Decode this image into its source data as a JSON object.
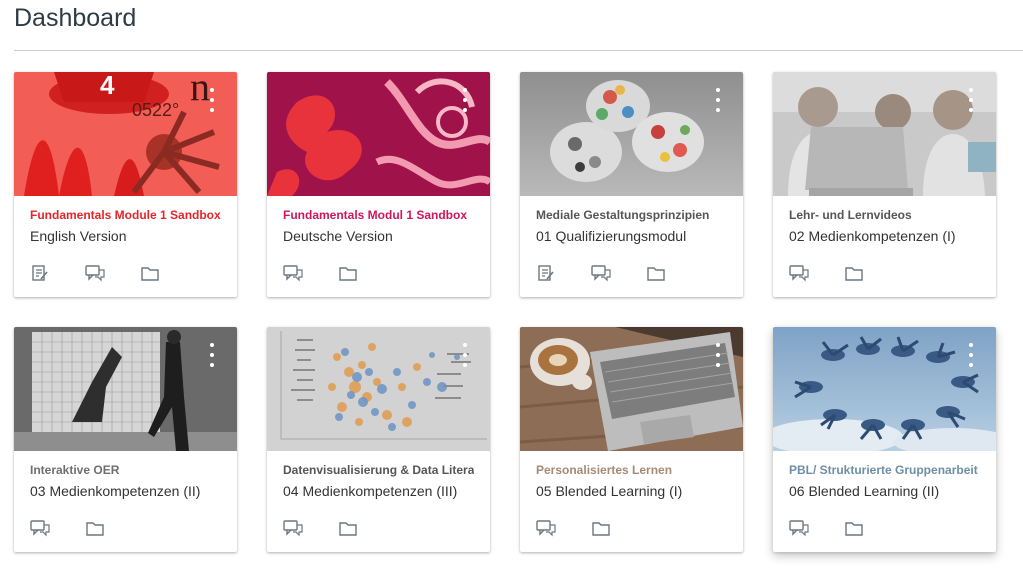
{
  "page": {
    "title": "Dashboard"
  },
  "cards": [
    {
      "course_name": "Fundamentals Module 1 Sandbox",
      "subtitle": "English Version",
      "name_color": "#e62429",
      "icons": [
        "assignments-icon",
        "discussions-icon",
        "files-icon"
      ],
      "image": "red-abstract-illustration",
      "image_text": {
        "big": "4",
        "num": "0522°",
        "glyph": "n"
      }
    },
    {
      "course_name": "Fundamentals Modul 1 Sandbox",
      "subtitle": "Deutsche Version",
      "name_color": "#d0155a",
      "icons": [
        "discussions-icon",
        "files-icon"
      ],
      "image": "magenta-abstract-illustration"
    },
    {
      "course_name": "Mediale Gestaltungsprinzipien",
      "subtitle": "01 Qualifizierungsmodul",
      "name_color": "#555555",
      "icons": [
        "assignments-icon",
        "discussions-icon",
        "files-icon"
      ],
      "image": "dotted-eggs-photo"
    },
    {
      "course_name": "Lehr- und Lernvideos",
      "subtitle": "02 Medienkompetenzen (I)",
      "name_color": "#555555",
      "icons": [
        "discussions-icon",
        "files-icon"
      ],
      "image": "girls-with-laptop-photo"
    },
    {
      "course_name": "Interaktive OER",
      "subtitle": "03 Medienkompetenzen (II)",
      "name_color": "#6f6f6f",
      "icons": [
        "discussions-icon",
        "files-icon"
      ],
      "image": "pixel-wall-photo"
    },
    {
      "course_name": "Datenvisualisierung & Data Literacy",
      "subtitle": "04 Medienkompetenzen (III)",
      "name_color": "#555555",
      "icons": [
        "discussions-icon",
        "files-icon"
      ],
      "image": "scatter-plot-image"
    },
    {
      "course_name": "Personalisiertes Lernen",
      "subtitle": "05 Blended Learning (I)",
      "name_color": "#a68a74",
      "icons": [
        "discussions-icon",
        "files-icon"
      ],
      "image": "coffee-laptop-photo"
    },
    {
      "course_name": "PBL/ Strukturierte Gruppenarbeit",
      "subtitle": "06 Blended Learning (II)",
      "name_color": "#6d8fa6",
      "icons": [
        "discussions-icon",
        "files-icon"
      ],
      "image": "skydivers-photo"
    }
  ]
}
